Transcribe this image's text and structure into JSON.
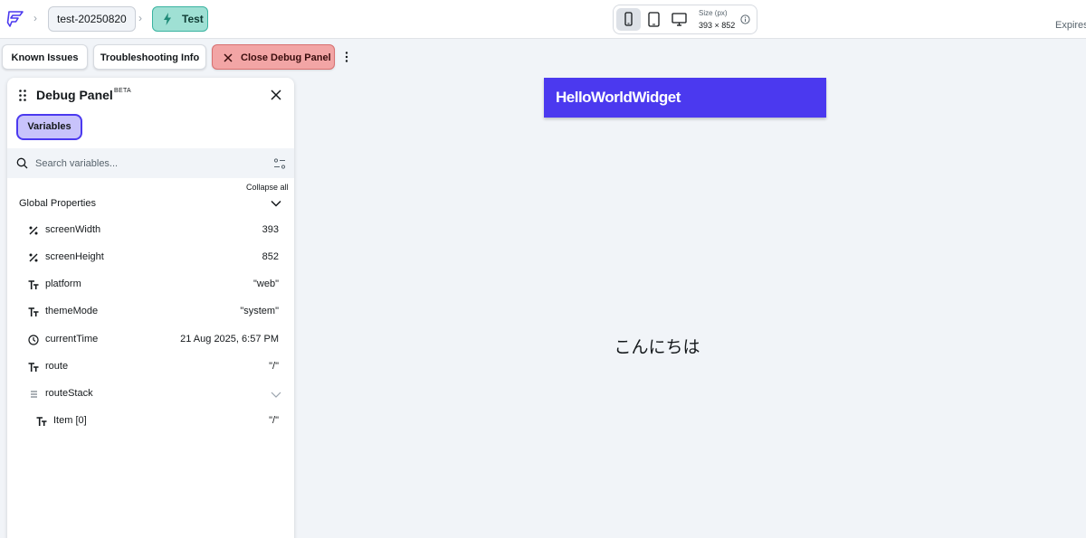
{
  "colors": {
    "primary": "#4b39ef",
    "background": "#f1f4f8",
    "test_chip": "#9fe0d4",
    "close_button": "#f2a5a5"
  },
  "topbar": {
    "logo_icon": "flutterflow-logo-icon",
    "breadcrumb": {
      "project": "test-20250820",
      "page": "Test",
      "page_icon": "bolt-icon"
    },
    "device_selector": {
      "devices": [
        "phone",
        "tablet",
        "desktop"
      ],
      "selected": "phone",
      "size_label": "Size (px)",
      "size_value": "393 × 852"
    },
    "expires_label": "Expires"
  },
  "actions": {
    "known_issues": "Known Issues",
    "troubleshooting": "Troubleshooting Info",
    "close_debug": "Close Debug Panel"
  },
  "debug_panel": {
    "title": "Debug Panel",
    "badge": "BETA",
    "tab": "Variables",
    "search_placeholder": "Search variables...",
    "collapse_all": "Collapse all",
    "group_title": "Global Properties",
    "variables": [
      {
        "type_icon": "number-type-icon",
        "name": "screenWidth",
        "value": "393"
      },
      {
        "type_icon": "number-type-icon",
        "name": "screenHeight",
        "value": "852"
      },
      {
        "type_icon": "text-type-icon",
        "name": "platform",
        "value": "\"web\""
      },
      {
        "type_icon": "text-type-icon",
        "name": "themeMode",
        "value": "\"system\""
      },
      {
        "type_icon": "clock-type-icon",
        "name": "currentTime",
        "value": "21 Aug 2025, 6:57 PM"
      },
      {
        "type_icon": "text-type-icon",
        "name": "route",
        "value": "\"/\""
      },
      {
        "type_icon": "list-type-icon",
        "name": "routeStack",
        "value": ""
      },
      {
        "type_icon": "text-type-icon",
        "name": "Item [0]",
        "value": "\"/\""
      }
    ]
  },
  "preview": {
    "app_bar_title": "HelloWorldWidget",
    "body_text": "こんにちは"
  }
}
